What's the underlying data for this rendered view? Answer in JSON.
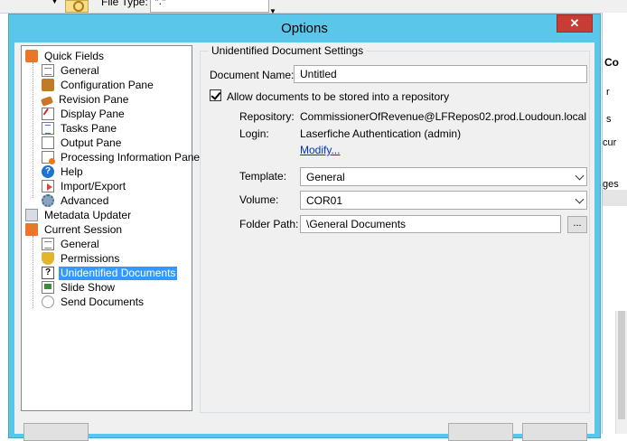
{
  "background": {
    "file_type_label": "File Type:",
    "file_type_value": "*.*",
    "right_fragments": [
      "Co",
      "r",
      "s",
      "cur",
      "ges"
    ]
  },
  "dialog": {
    "title": "Options",
    "close_glyph": "✕"
  },
  "tree": {
    "quick_fields": {
      "label": "Quick Fields",
      "children": [
        "General",
        "Configuration Pane",
        "Revision Pane",
        "Display Pane",
        "Tasks Pane",
        "Output Pane",
        "Processing Information Pane",
        "Help",
        "Import/Export",
        "Advanced"
      ]
    },
    "metadata_updater": "Metadata Updater",
    "current_session": {
      "label": "Current Session",
      "children": [
        "General",
        "Permissions",
        "Unidentified Documents",
        "Slide Show",
        "Send Documents"
      ]
    },
    "selected": "Unidentified Documents",
    "help_glyph": "?",
    "unidentified_glyph": "?"
  },
  "settings": {
    "group_title": "Unidentified Document Settings",
    "document_name_label": "Document Name:",
    "document_name_value": "Untitled",
    "allow_repo_label": "Allow documents to be stored into a repository",
    "allow_repo_checked": true,
    "repository_label": "Repository:",
    "repository_value": "CommissionerOfRevenue@LFRepos02.prod.Loudoun.local",
    "login_label": "Login:",
    "login_value": "Laserfiche Authentication (admin)",
    "modify_link": "Modify...",
    "template_label": "Template:",
    "template_value": "General",
    "volume_label": "Volume:",
    "volume_value": "COR01",
    "folder_path_label": "Folder Path:",
    "folder_path_value": "\\General Documents",
    "browse_label": "..."
  }
}
